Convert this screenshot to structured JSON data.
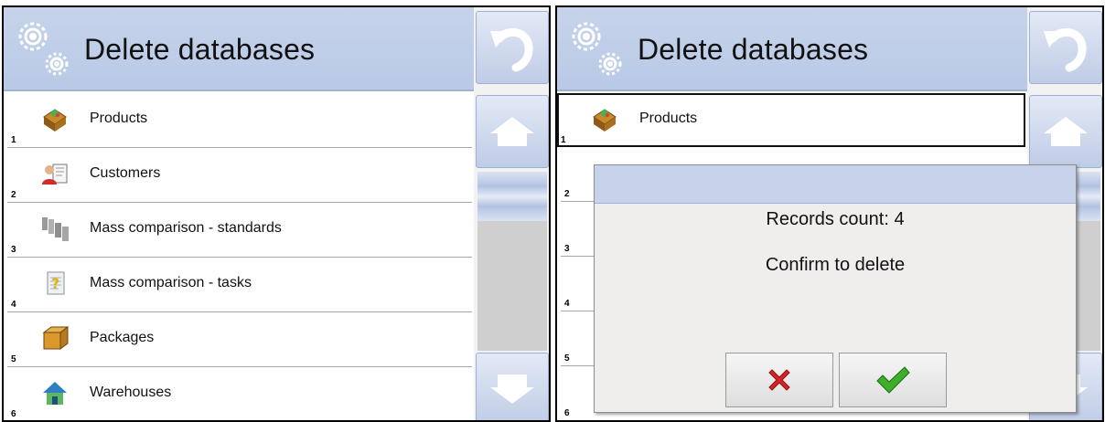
{
  "left_panel": {
    "title": "Delete databases",
    "items": [
      {
        "number": "1",
        "label": "Products",
        "icon": "products-icon"
      },
      {
        "number": "2",
        "label": "Customers",
        "icon": "customers-icon"
      },
      {
        "number": "3",
        "label": "Mass comparison - standards",
        "icon": "standards-icon"
      },
      {
        "number": "4",
        "label": "Mass comparison - tasks",
        "icon": "tasks-icon"
      },
      {
        "number": "5",
        "label": "Packages",
        "icon": "package-icon"
      },
      {
        "number": "6",
        "label": "Warehouses",
        "icon": "warehouse-icon"
      }
    ]
  },
  "right_panel": {
    "title": "Delete databases",
    "selected_item": {
      "number": "1",
      "label": "Products",
      "icon": "products-icon"
    },
    "row_numbers": [
      "2",
      "3",
      "4",
      "5",
      "6"
    ],
    "dialog": {
      "records_text": "Records count: 4",
      "confirm_text": "Confirm to delete",
      "cancel_icon": "red-x-icon",
      "ok_icon": "green-check-icon"
    }
  },
  "colors": {
    "header_bg": "#c6d3ea",
    "button_bg": "#bfcce6",
    "cancel": "#d6232a",
    "confirm": "#3fae2a"
  }
}
